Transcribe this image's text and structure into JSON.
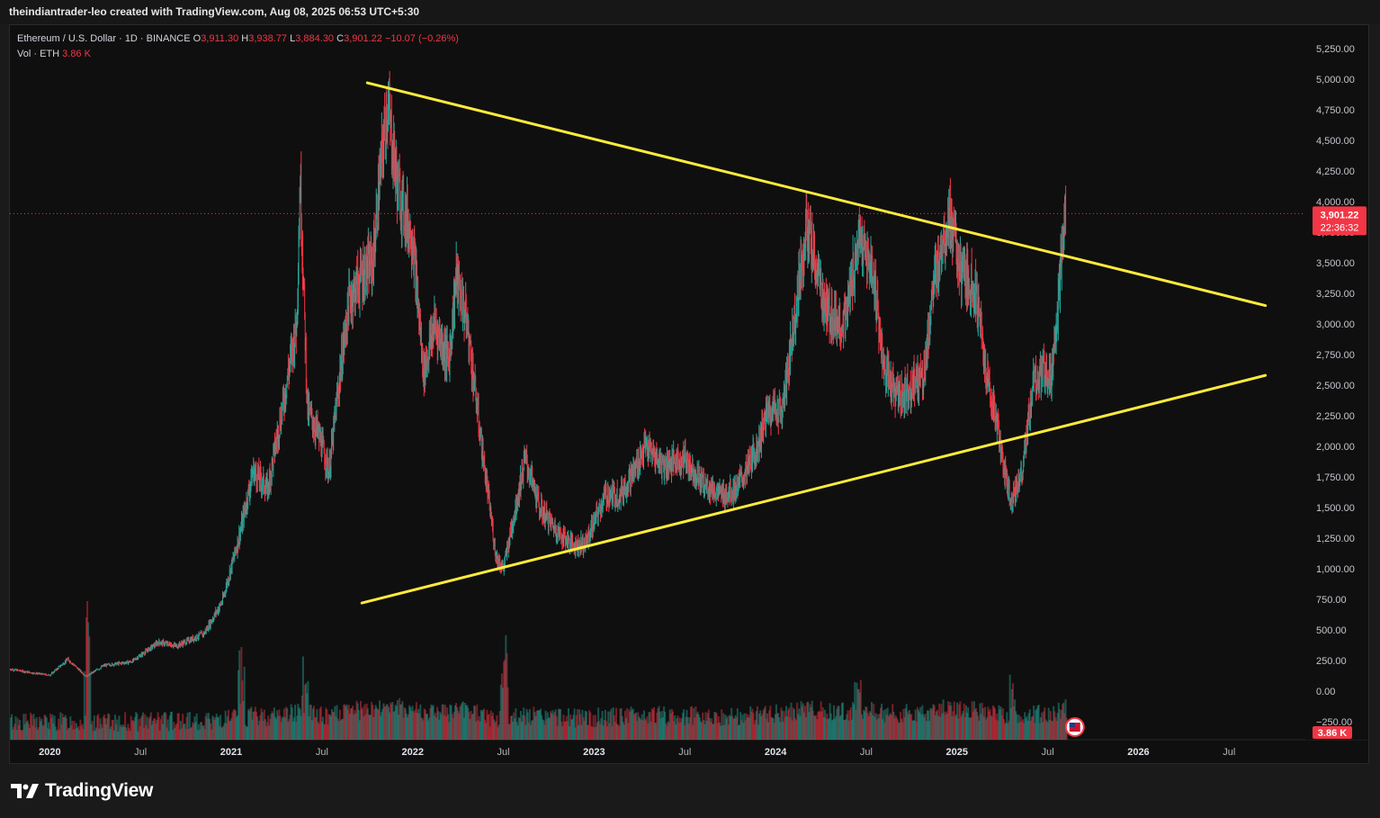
{
  "header": {
    "attribution": "theindiantrader-leo created with TradingView.com, Aug 08, 2025 06:53 UTC+5:30"
  },
  "legend": {
    "symbol": "Ethereum / U.S. Dollar · 1D · BINANCE",
    "o_label": "O",
    "o_value": "3,911.30",
    "h_label": "H",
    "h_value": "3,938.77",
    "l_label": "L",
    "l_value": "3,884.30",
    "c_label": "C",
    "c_value": "3,901.22",
    "change": "−10.07 (−0.26%)",
    "vol_label": "Vol · ETH",
    "vol_value": "3.86 K"
  },
  "price_badge": {
    "price": "3,901.22",
    "countdown": "22:36:32"
  },
  "volume_badge": "3.86 K",
  "footer": {
    "brand": "TradingView",
    "logo_icon": "tradingview-logo-icon"
  },
  "colors": {
    "up": "#26a69a",
    "down": "#f23645",
    "trendline": "#ffeb3b",
    "background": "#0f0f0f"
  },
  "chart_data": {
    "type": "candlestick",
    "title": "Ethereum / U.S. Dollar · 1D · BINANCE",
    "y_ticks": [
      "5,250.00",
      "5,000.00",
      "4,750.00",
      "4,500.00",
      "4,250.00",
      "4,000.00",
      "3,750.00",
      "3,500.00",
      "3,250.00",
      "3,000.00",
      "2,750.00",
      "2,500.00",
      "2,250.00",
      "2,000.00",
      "1,750.00",
      "1,500.00",
      "1,250.00",
      "1,000.00",
      "750.00",
      "500.00",
      "250.00",
      "0.00",
      "−250.00"
    ],
    "y_tick_values": [
      5250,
      5000,
      4750,
      4500,
      4250,
      4000,
      3750,
      3500,
      3250,
      3000,
      2750,
      2500,
      2250,
      2000,
      1750,
      1500,
      1250,
      1000,
      750,
      500,
      250,
      0,
      -250
    ],
    "ylim": [
      -250,
      5250
    ],
    "x_ticks": [
      {
        "label": "2020",
        "t": 2020.0
      },
      {
        "label": "Jul",
        "t": 2020.5
      },
      {
        "label": "2021",
        "t": 2021.0
      },
      {
        "label": "Jul",
        "t": 2021.5
      },
      {
        "label": "2022",
        "t": 2022.0
      },
      {
        "label": "Jul",
        "t": 2022.5
      },
      {
        "label": "2023",
        "t": 2023.0
      },
      {
        "label": "Jul",
        "t": 2023.5
      },
      {
        "label": "2024",
        "t": 2024.0
      },
      {
        "label": "Jul",
        "t": 2024.5
      },
      {
        "label": "2025",
        "t": 2025.0
      },
      {
        "label": "Jul",
        "t": 2025.5
      },
      {
        "label": "2026",
        "t": 2026.0
      },
      {
        "label": "Jul",
        "t": 2026.5
      }
    ],
    "bold_years": [
      "2020",
      "2021",
      "2022",
      "2023",
      "2024",
      "2025",
      "2026"
    ],
    "price_series": [
      [
        2019.78,
        180
      ],
      [
        2019.9,
        150
      ],
      [
        2020.0,
        130
      ],
      [
        2020.1,
        260
      ],
      [
        2020.2,
        120
      ],
      [
        2020.3,
        210
      ],
      [
        2020.45,
        240
      ],
      [
        2020.6,
        400
      ],
      [
        2020.7,
        370
      ],
      [
        2020.85,
        470
      ],
      [
        2020.95,
        730
      ],
      [
        2021.05,
        1300
      ],
      [
        2021.12,
        1800
      ],
      [
        2021.2,
        1650
      ],
      [
        2021.28,
        2300
      ],
      [
        2021.36,
        3000
      ],
      [
        2021.38,
        4200
      ],
      [
        2021.42,
        2300
      ],
      [
        2021.48,
        2100
      ],
      [
        2021.54,
        1800
      ],
      [
        2021.6,
        2600
      ],
      [
        2021.65,
        3200
      ],
      [
        2021.72,
        3400
      ],
      [
        2021.78,
        3500
      ],
      [
        2021.82,
        4200
      ],
      [
        2021.86,
        4800
      ],
      [
        2021.92,
        4100
      ],
      [
        2022.0,
        3700
      ],
      [
        2022.06,
        2600
      ],
      [
        2022.12,
        3000
      ],
      [
        2022.2,
        2700
      ],
      [
        2022.24,
        3400
      ],
      [
        2022.3,
        3000
      ],
      [
        2022.38,
        2000
      ],
      [
        2022.46,
        1100
      ],
      [
        2022.5,
        1000
      ],
      [
        2022.58,
        1600
      ],
      [
        2022.62,
        1900
      ],
      [
        2022.7,
        1500
      ],
      [
        2022.8,
        1300
      ],
      [
        2022.88,
        1200
      ],
      [
        2022.95,
        1200
      ],
      [
        2023.06,
        1600
      ],
      [
        2023.14,
        1600
      ],
      [
        2023.22,
        1800
      ],
      [
        2023.28,
        2000
      ],
      [
        2023.38,
        1850
      ],
      [
        2023.5,
        1900
      ],
      [
        2023.6,
        1700
      ],
      [
        2023.7,
        1600
      ],
      [
        2023.78,
        1650
      ],
      [
        2023.84,
        1800
      ],
      [
        2023.9,
        2000
      ],
      [
        2023.96,
        2300
      ],
      [
        2024.04,
        2300
      ],
      [
        2024.1,
        3000
      ],
      [
        2024.17,
        3800
      ],
      [
        2024.2,
        3600
      ],
      [
        2024.28,
        3100
      ],
      [
        2024.38,
        3000
      ],
      [
        2024.46,
        3700
      ],
      [
        2024.54,
        3400
      ],
      [
        2024.6,
        2600
      ],
      [
        2024.68,
        2400
      ],
      [
        2024.75,
        2500
      ],
      [
        2024.82,
        2600
      ],
      [
        2024.86,
        3200
      ],
      [
        2024.92,
        3700
      ],
      [
        2024.96,
        3900
      ],
      [
        2025.02,
        3400
      ],
      [
        2025.1,
        3300
      ],
      [
        2025.16,
        2600
      ],
      [
        2025.22,
        2200
      ],
      [
        2025.26,
        1800
      ],
      [
        2025.3,
        1550
      ],
      [
        2025.36,
        1800
      ],
      [
        2025.42,
        2500
      ],
      [
        2025.48,
        2600
      ],
      [
        2025.52,
        2600
      ],
      [
        2025.56,
        3200
      ],
      [
        2025.58,
        3600
      ],
      [
        2025.6,
        3900
      ]
    ],
    "volume_spikes": [
      [
        2020.2,
        150
      ],
      [
        2021.05,
        90
      ],
      [
        2021.4,
        70
      ],
      [
        2022.5,
        100
      ],
      [
        2024.45,
        40
      ],
      [
        2025.3,
        40
      ]
    ],
    "trendlines": [
      {
        "name": "descending-resistance",
        "from": [
          2021.75,
          4970
        ],
        "to": [
          2026.7,
          3150
        ]
      },
      {
        "name": "ascending-support",
        "from": [
          2021.72,
          720
        ],
        "to": [
          2026.7,
          2580
        ]
      }
    ],
    "current_price": 3901.22,
    "grid": false
  }
}
